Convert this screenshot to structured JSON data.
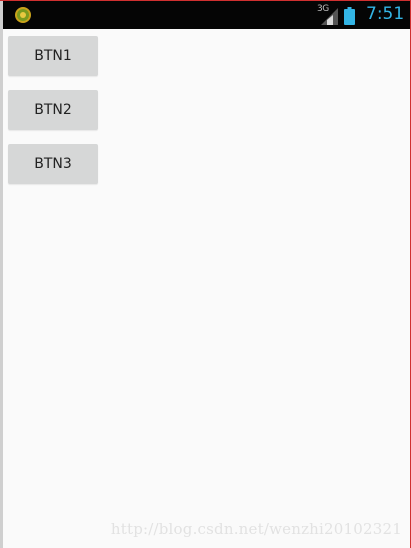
{
  "status_bar": {
    "network_type": "3G",
    "time": "7:51",
    "clock_color": "#33b5e5",
    "app_icon": "app-notification-icon",
    "signal_icon": "signal-icon",
    "battery_icon": "battery-icon"
  },
  "buttons": [
    {
      "label": "BTN1"
    },
    {
      "label": "BTN2"
    },
    {
      "label": "BTN3"
    }
  ],
  "watermark": "http://blog.csdn.net/wenzhi20102321"
}
